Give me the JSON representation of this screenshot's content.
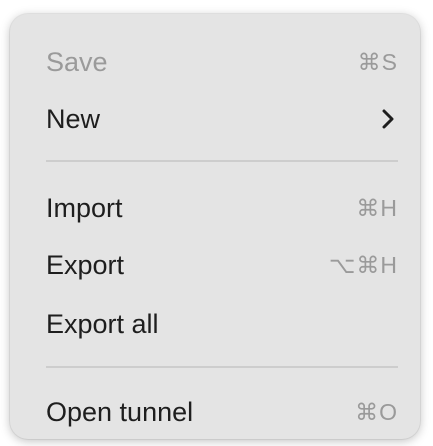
{
  "menu": {
    "items": [
      {
        "label": "Save",
        "shortcut": "⌘S",
        "disabled": true
      },
      {
        "label": "New",
        "submenu": true,
        "icon": "chevron-right-icon"
      },
      {
        "label": "Import",
        "shortcut": "⌘H"
      },
      {
        "label": "Export",
        "shortcut": "⌥⌘H"
      },
      {
        "label": "Export all"
      },
      {
        "label": "Open tunnel",
        "shortcut": "⌘O"
      }
    ]
  },
  "colors": {
    "menu_background": "#e4e4e4",
    "text": "#1e1e1e",
    "disabled_text": "#9a9a9a",
    "separator": "#cdcdcd"
  }
}
